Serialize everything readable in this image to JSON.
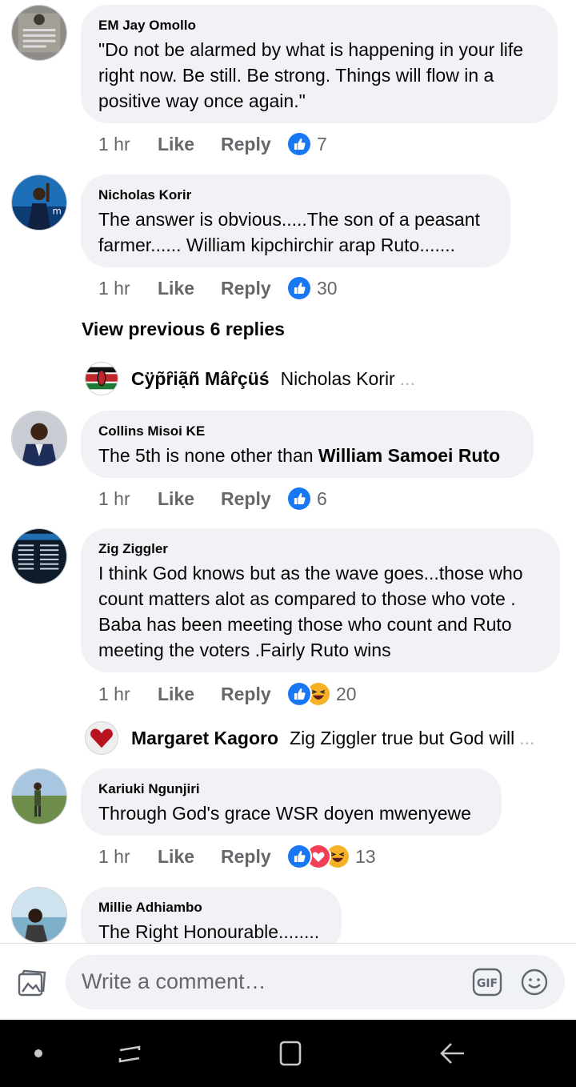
{
  "comments": [
    {
      "author": "EM Jay Omollo",
      "lines": [
        "\"Do not be alarmed by what is happening in your life",
        "right now. Be still.  Be strong. Things will flow in a",
        "positive way once again.\""
      ],
      "time": "1 hr",
      "like": "Like",
      "reply": "Reply",
      "count": "7",
      "reactions": [
        "like-icon"
      ]
    },
    {
      "author": "Nicholas Korir",
      "lines": [
        "The answer is obvious.....The son of a peasant",
        "farmer...... William kipchirchir arap Ruto......."
      ],
      "time": "1 hr",
      "like": "Like",
      "reply": "Reply",
      "count": "30",
      "reactions": [
        "like-icon"
      ]
    },
    {
      "author": "Collins Misoi KE",
      "text_plain": "The 5th is none other than ",
      "text_bold": "William Samoei Ruto",
      "time": "1 hr",
      "like": "Like",
      "reply": "Reply",
      "count": "6",
      "reactions": [
        "like-icon"
      ]
    },
    {
      "author": "Zig Ziggler",
      "lines": [
        "I think God knows but as the wave goes...those who",
        "count matters alot as compared to those who vote .",
        "Baba has been meeting those who count and Ruto",
        "meeting the voters .Fairly Ruto wins"
      ],
      "time": "1 hr",
      "like": "Like",
      "reply": "Reply",
      "count": "20",
      "reactions": [
        "like-icon",
        "haha-icon"
      ]
    },
    {
      "author": "Kariuki Ngunjiri",
      "lines": [
        "Through God's grace WSR doyen mwenyewe"
      ],
      "time": "1 hr",
      "like": "Like",
      "reply": "Reply",
      "count": "13",
      "reactions": [
        "like-icon",
        "love-icon",
        "haha-icon"
      ]
    },
    {
      "author": "Millie Adhiambo",
      "lines": [
        "The Right Honourable........"
      ]
    }
  ],
  "view_previous": "View previous 6 replies",
  "reply_previews": [
    {
      "name": "Cÿp̃ȓiạ̃ñ Mâȓçüś",
      "text": "Nicholas Korir",
      "ellipsis": "..."
    },
    {
      "name": "Margaret Kagoro",
      "text": "Zig Ziggler true but God will",
      "ellipsis": "..."
    }
  ],
  "composer": {
    "placeholder": "Write a comment…",
    "gif_label": "GIF"
  },
  "colors": {
    "accent": "#1877f2",
    "bubble": "#f0f2f5",
    "meta": "#65676b",
    "love": "#f33e58",
    "haha": "#f7b125"
  }
}
